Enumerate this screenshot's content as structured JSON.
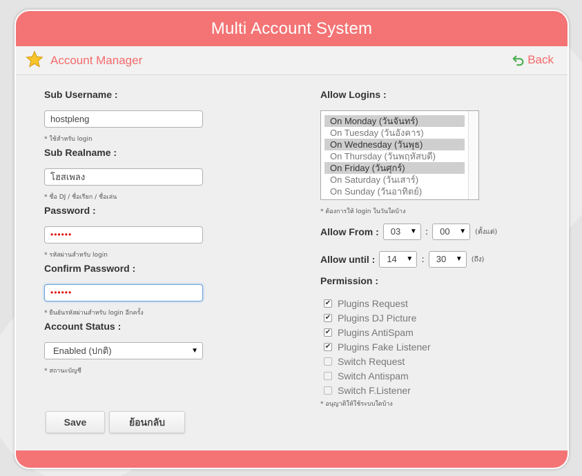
{
  "header": {
    "title": "Multi Account System"
  },
  "subbar": {
    "title": "Account Manager",
    "back_label": "Back"
  },
  "form": {
    "sub_username": {
      "label": "Sub Username :",
      "value": "hostpleng",
      "hint": "* ใช้สำหรับ login"
    },
    "sub_realname": {
      "label": "Sub Realname :",
      "value": "โฮสเพลง",
      "hint": "* ชื่อ DJ / ชื่อเรียก / ชื่อเล่น"
    },
    "password": {
      "label": "Password :",
      "value": "••••••",
      "hint": "* รหัสผ่านสำหรับ login"
    },
    "confirm_password": {
      "label": "Confirm Password :",
      "value": "••••••",
      "hint": "* ยืนยันรหัสผ่านสำหรับ login อีกครั้ง"
    },
    "account_status": {
      "label": "Account Status :",
      "value": "Enabled (ปกติ)",
      "hint": "* สถานะบัญชี"
    }
  },
  "allow_logins": {
    "label": "Allow Logins :",
    "options": [
      {
        "text": "On Monday (วันจันทร์)",
        "selected": true
      },
      {
        "text": "On Tuesday (วันอังคาร)",
        "selected": false
      },
      {
        "text": "On Wednesday (วันพุธ)",
        "selected": true
      },
      {
        "text": "On Thursday (วันพฤหัสบดี)",
        "selected": false
      },
      {
        "text": "On Friday (วันศุกร์)",
        "selected": true
      },
      {
        "text": "On Saturday (วันเสาร์)",
        "selected": false
      },
      {
        "text": "On Sunday (วันอาทิตย์)",
        "selected": false
      }
    ],
    "hint": "* ต้องการให้ login ในวันใดบ้าง"
  },
  "allow_from": {
    "label": "Allow From :",
    "hour": "03",
    "minute": "00",
    "unit": "(ตั้งแต่)"
  },
  "allow_until": {
    "label": "Allow until :",
    "hour": "14",
    "minute": "30",
    "unit": "(ถึง)"
  },
  "permission": {
    "label": "Permission :",
    "items": [
      {
        "label": "Plugins Request",
        "checked": true
      },
      {
        "label": "Plugins DJ Picture",
        "checked": true
      },
      {
        "label": "Plugins AntiSpam",
        "checked": true
      },
      {
        "label": "Plugins Fake Listener",
        "checked": true
      },
      {
        "label": "Switch Request",
        "checked": false
      },
      {
        "label": "Switch Antispam",
        "checked": false
      },
      {
        "label": "Switch F.Listener",
        "checked": false
      }
    ],
    "hint": "* อนุญาติให้ใช้ระบบใดบ้าง"
  },
  "buttons": {
    "save": "Save",
    "back": "ย้อนกลับ"
  },
  "colors": {
    "accent": "#f47374",
    "accent_text": "#f46a6b"
  }
}
